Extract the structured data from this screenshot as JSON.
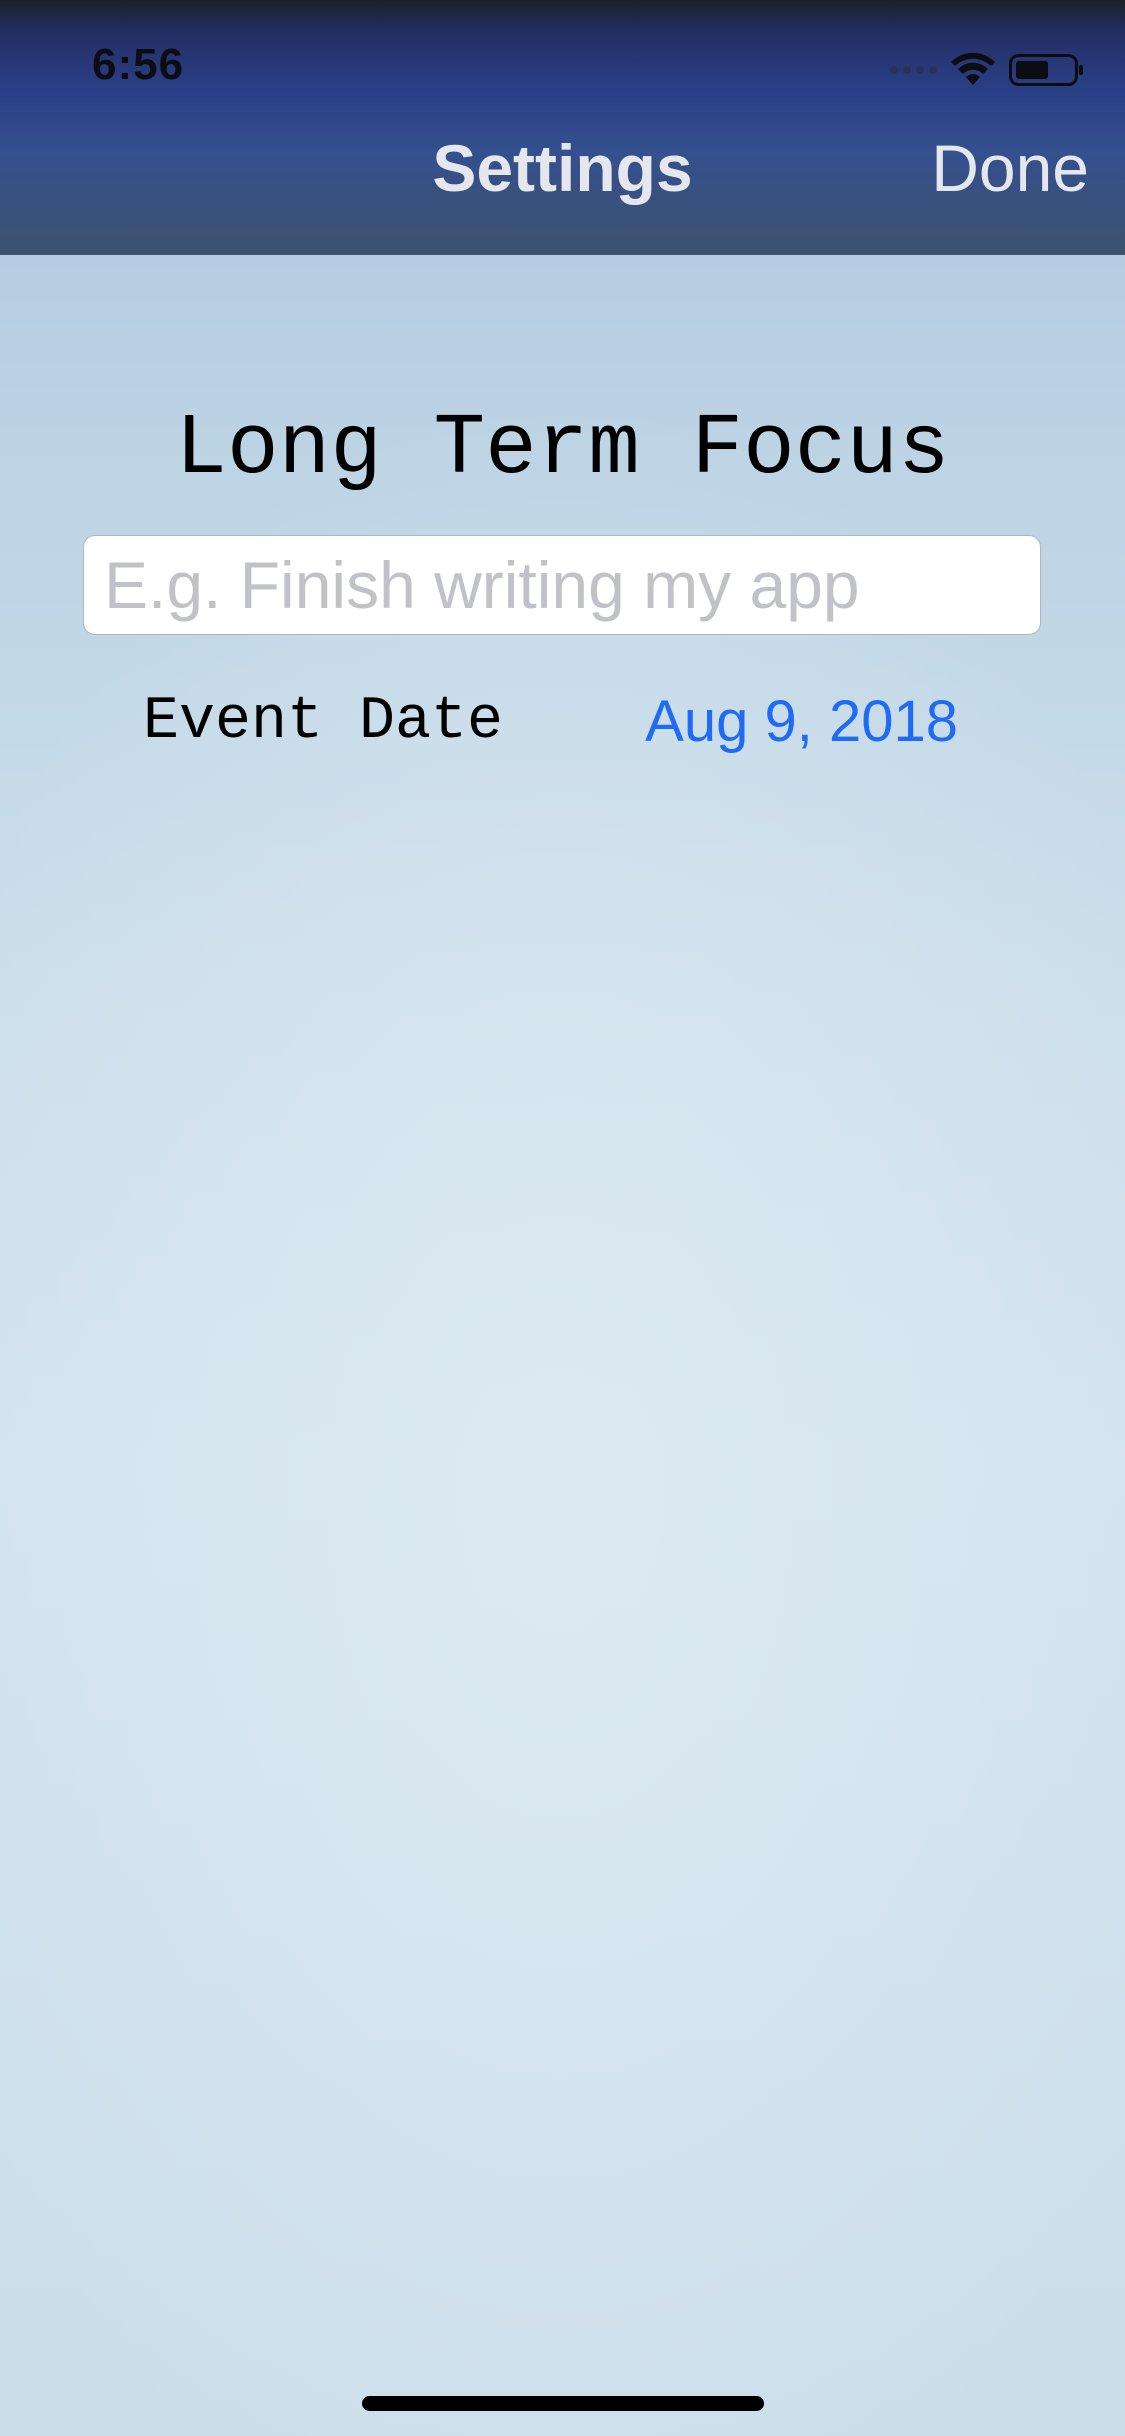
{
  "status_bar": {
    "time": "6:56",
    "icons": [
      "signal-dots-icon",
      "wifi-icon",
      "battery-icon"
    ]
  },
  "nav_bar": {
    "title": "Settings",
    "done_label": "Done"
  },
  "content": {
    "title": "Long Term Focus",
    "focus_input": {
      "value": "",
      "placeholder": "E.g. Finish writing my app"
    },
    "event_date": {
      "label": "Event Date",
      "value": "Aug 9, 2018"
    }
  },
  "colors": {
    "accent": "#1f6bf5",
    "nav_text": "#e6e7ec"
  }
}
